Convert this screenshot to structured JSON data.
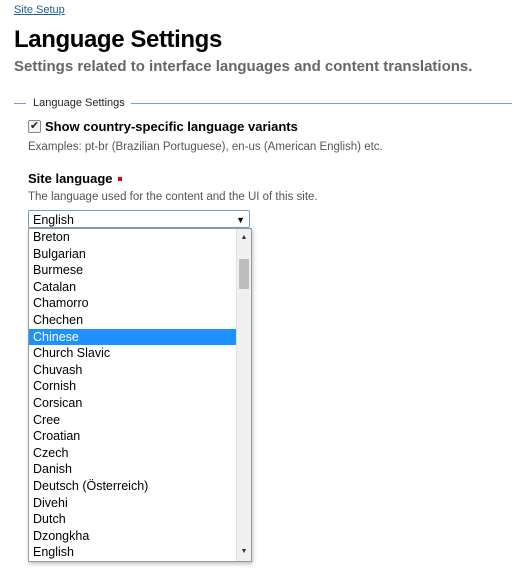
{
  "breadcrumb": "Site Setup",
  "title": "Language Settings",
  "subtitle": "Settings related to interface languages and content translations.",
  "fieldset_legend": "Language Settings",
  "country_variants": {
    "label": "Show country-specific language variants",
    "checked": true,
    "help": "Examples: pt-br (Brazilian Portuguese), en-us (American English) etc."
  },
  "site_language": {
    "label": "Site language",
    "help": "The language used for the content and the UI of this site.",
    "selected": "English",
    "highlighted": "Chinese",
    "options": [
      "Breton",
      "Bulgarian",
      "Burmese",
      "Catalan",
      "Chamorro",
      "Chechen",
      "Chinese",
      "Church Slavic",
      "Chuvash",
      "Cornish",
      "Corsican",
      "Cree",
      "Croatian",
      "Czech",
      "Danish",
      "Deutsch (Österreich)",
      "Divehi",
      "Dutch",
      "Dzongkha",
      "English"
    ]
  },
  "icons": {
    "dropdown_arrow": "▼",
    "scroll_up": "▲",
    "scroll_down": "▼",
    "check": "✔"
  },
  "colors": {
    "link": "#205c90",
    "highlight": "#1e90ff",
    "required": "#ee0000"
  }
}
